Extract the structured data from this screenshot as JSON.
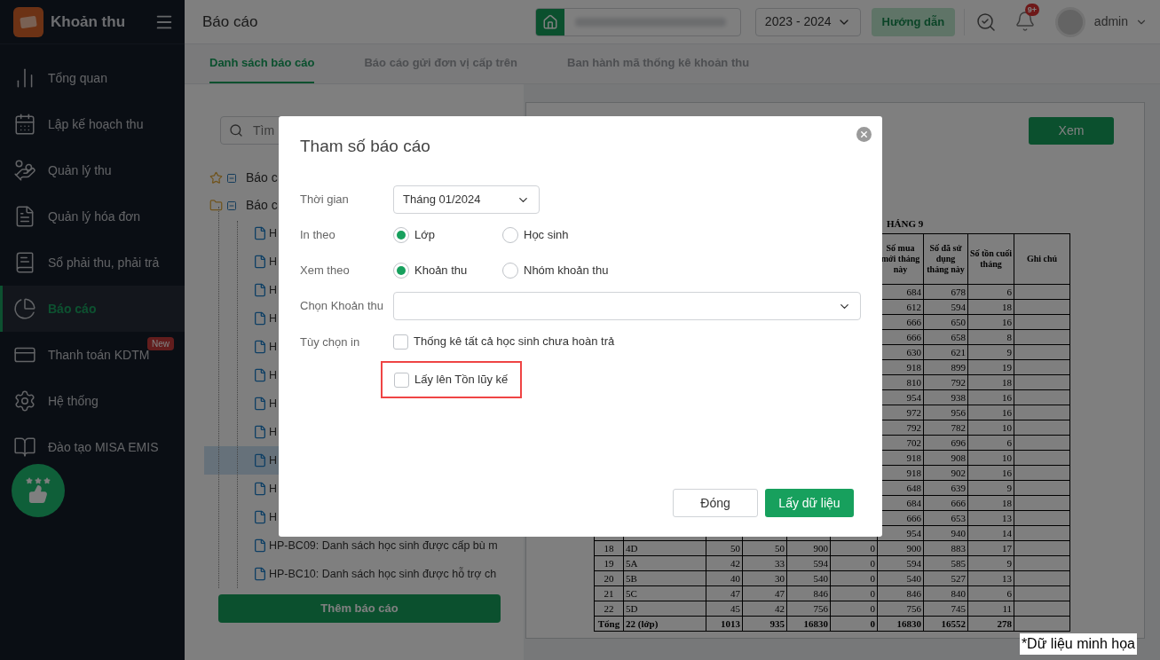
{
  "app": {
    "name": "Khoản thu"
  },
  "sidebar": {
    "items": [
      {
        "label": "Tổng quan",
        "selected": false
      },
      {
        "label": "Lập kế hoạch thu",
        "selected": false
      },
      {
        "label": "Quản lý thu",
        "selected": false
      },
      {
        "label": "Quản lý hóa đơn",
        "selected": false
      },
      {
        "label": "Sổ phải thu, phải trả",
        "selected": false
      },
      {
        "label": "Báo cáo",
        "selected": true
      },
      {
        "label": "Thanh toán KDTM",
        "selected": false,
        "badge": "New"
      },
      {
        "label": "Hệ thống",
        "selected": false
      },
      {
        "label": "Đào tạo MISA EMIS",
        "selected": false
      }
    ]
  },
  "header": {
    "title": "Báo cáo",
    "school_year": "2023 - 2024",
    "help_button": "Hướng dẫn",
    "notification_badge": "9+",
    "user": "admin"
  },
  "tabs": [
    {
      "label": "Danh sách báo cáo",
      "selected": true
    },
    {
      "label": "Báo cáo gửi đơn vị cấp trên",
      "selected": false
    },
    {
      "label": "Ban hành mã thống kê khoản thu",
      "selected": false
    }
  ],
  "report_list": {
    "search_placeholder": "Tìm",
    "groups": [
      {
        "kind": "favorite",
        "label": "Báo c",
        "expanded": true
      },
      {
        "kind": "folder",
        "label": "Báo c",
        "expanded": true,
        "children": [
          {
            "label": "H",
            "selected": false
          },
          {
            "label": "H",
            "selected": false
          },
          {
            "label": "H",
            "selected": false
          },
          {
            "label": "H",
            "selected": false
          },
          {
            "label": "H",
            "selected": false
          },
          {
            "label": "H",
            "selected": false
          },
          {
            "label": "H",
            "selected": false
          },
          {
            "label": "H",
            "selected": false
          },
          {
            "label": "H",
            "selected": true
          },
          {
            "label": "H",
            "selected": false
          },
          {
            "label": "H",
            "selected": false
          },
          {
            "label": "HP-BC09: Danh sách học sinh được cấp bù m",
            "selected": false
          },
          {
            "label": "HP-BC10: Danh sách học sinh được hỗ trợ ch",
            "selected": false
          }
        ]
      }
    ],
    "add_button": "Thêm báo cáo"
  },
  "preview": {
    "view_button": "Xem",
    "title": "HÁNG 9",
    "table": {
      "columns": [
        "Số mua mới tháng này",
        "Số đã sử dụng tháng này",
        "Số tồn cuối tháng",
        "Ghi chú"
      ],
      "rows": [
        {
          "cells": [
            "684",
            "678",
            "6"
          ],
          "total": false
        },
        {
          "cells": [
            "612",
            "594",
            "18"
          ],
          "total": false
        },
        {
          "cells": [
            "666",
            "650",
            "16"
          ],
          "total": false
        },
        {
          "cells": [
            "666",
            "658",
            "8"
          ],
          "total": false
        },
        {
          "cells": [
            "630",
            "621",
            "9"
          ],
          "total": false
        },
        {
          "cells": [
            "918",
            "899",
            "19"
          ],
          "total": false
        },
        {
          "cells": [
            "810",
            "792",
            "18"
          ],
          "total": false
        },
        {
          "cells": [
            "954",
            "938",
            "16"
          ],
          "total": false
        },
        {
          "cells": [
            "972",
            "956",
            "16"
          ],
          "total": false
        },
        {
          "cells": [
            "792",
            "782",
            "10"
          ],
          "total": false
        },
        {
          "cells": [
            "702",
            "696",
            "6"
          ],
          "total": false
        },
        {
          "cells": [
            "918",
            "908",
            "10"
          ],
          "total": false
        },
        {
          "cells": [
            "918",
            "902",
            "16"
          ],
          "total": false
        },
        {
          "cells": [
            "648",
            "639",
            "9"
          ],
          "total": false
        },
        {
          "cells": [
            "684",
            "666",
            "18"
          ],
          "total": false
        },
        {
          "cells": [
            "666",
            "653",
            "13"
          ],
          "total": false
        },
        {
          "cells": [
            "954",
            "940",
            "14"
          ],
          "total": false
        },
        {
          "cells": [
            "18",
            "4D",
            "50",
            "50",
            "900",
            "0",
            "900",
            "883",
            "17"
          ],
          "total": false
        },
        {
          "cells": [
            "19",
            "5A",
            "42",
            "33",
            "594",
            "0",
            "594",
            "585",
            "9"
          ],
          "total": false
        },
        {
          "cells": [
            "20",
            "5B",
            "40",
            "30",
            "540",
            "0",
            "540",
            "527",
            "13"
          ],
          "total": false
        },
        {
          "cells": [
            "21",
            "5C",
            "47",
            "47",
            "846",
            "0",
            "846",
            "840",
            "6"
          ],
          "total": false
        },
        {
          "cells": [
            "22",
            "5D",
            "45",
            "42",
            "756",
            "0",
            "756",
            "745",
            "11"
          ],
          "total": false
        },
        {
          "cells": [
            "Tổng",
            "22 (lớp)",
            "1013",
            "935",
            "16830",
            "0",
            "16830",
            "16552",
            "278"
          ],
          "total": true
        }
      ]
    }
  },
  "dialog": {
    "title": "Tham số báo cáo",
    "fields": [
      {
        "kind": "select",
        "label": "Thời gian",
        "value": "Tháng 01/2024"
      },
      {
        "kind": "radio",
        "label": "In theo",
        "options": [
          {
            "label": "Lớp",
            "selected": true
          },
          {
            "label": "Học sinh",
            "selected": false
          }
        ]
      },
      {
        "kind": "radio",
        "label": "Xem theo",
        "options": [
          {
            "label": "Khoản thu",
            "selected": true
          },
          {
            "label": "Nhóm khoản thu",
            "selected": false
          }
        ]
      },
      {
        "kind": "combobox",
        "label": "Chọn Khoản thu"
      },
      {
        "kind": "checkboxes",
        "label": "Tùy chọn in",
        "options": [
          {
            "label": "Thống kê tất cả học sinh chưa hoàn trả",
            "checked": false,
            "highlighted": false
          },
          {
            "label": "Lấy lên Tồn lũy kế",
            "checked": false,
            "highlighted": true
          }
        ]
      }
    ],
    "buttons": [
      {
        "label": "Đóng",
        "kind": "secondary"
      },
      {
        "label": "Lấy dữ liệu",
        "kind": "primary"
      }
    ]
  },
  "caption": "*Dữ liệu minh họa"
}
